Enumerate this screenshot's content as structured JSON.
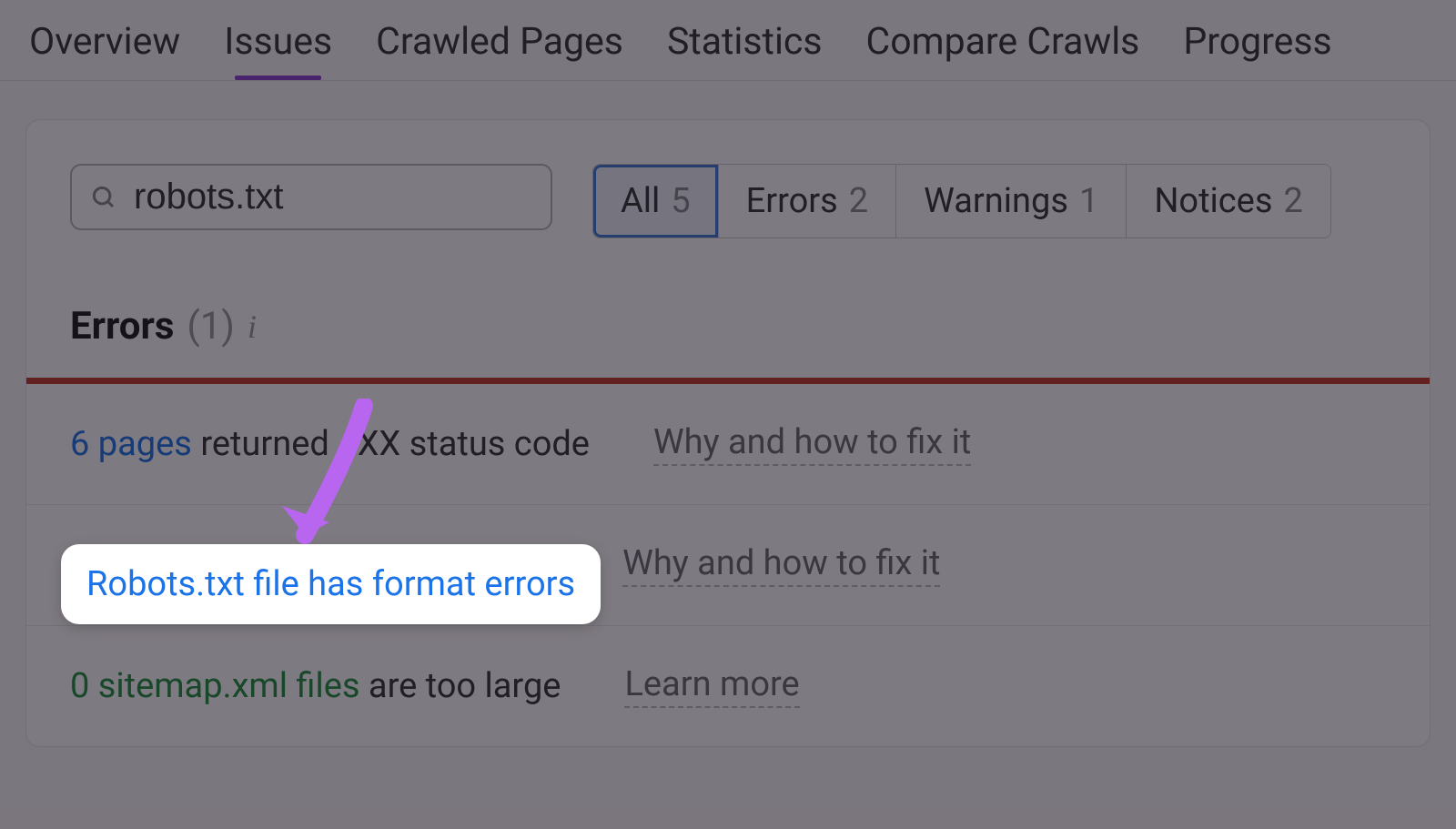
{
  "tabs": {
    "overview": "Overview",
    "issues": "Issues",
    "crawled": "Crawled Pages",
    "statistics": "Statistics",
    "compare": "Compare Crawls",
    "progress": "Progress"
  },
  "search": {
    "value": "robots.txt"
  },
  "filters": [
    {
      "label": "All",
      "count": "5"
    },
    {
      "label": "Errors",
      "count": "2"
    },
    {
      "label": "Warnings",
      "count": "1"
    },
    {
      "label": "Notices",
      "count": "2"
    }
  ],
  "section": {
    "label": "Errors",
    "count": "(1)"
  },
  "rows": [
    {
      "link": "6 pages",
      "text": " returned 4XX status code",
      "help": "Why and how to fix it"
    },
    {
      "link": "Robots.txt file has format errors",
      "text": "",
      "help": "Why and how to fix it"
    },
    {
      "link": "0 sitemap.xml files",
      "text": " are too large",
      "help": "Learn more"
    }
  ],
  "highlight": "Robots.txt file has format errors"
}
